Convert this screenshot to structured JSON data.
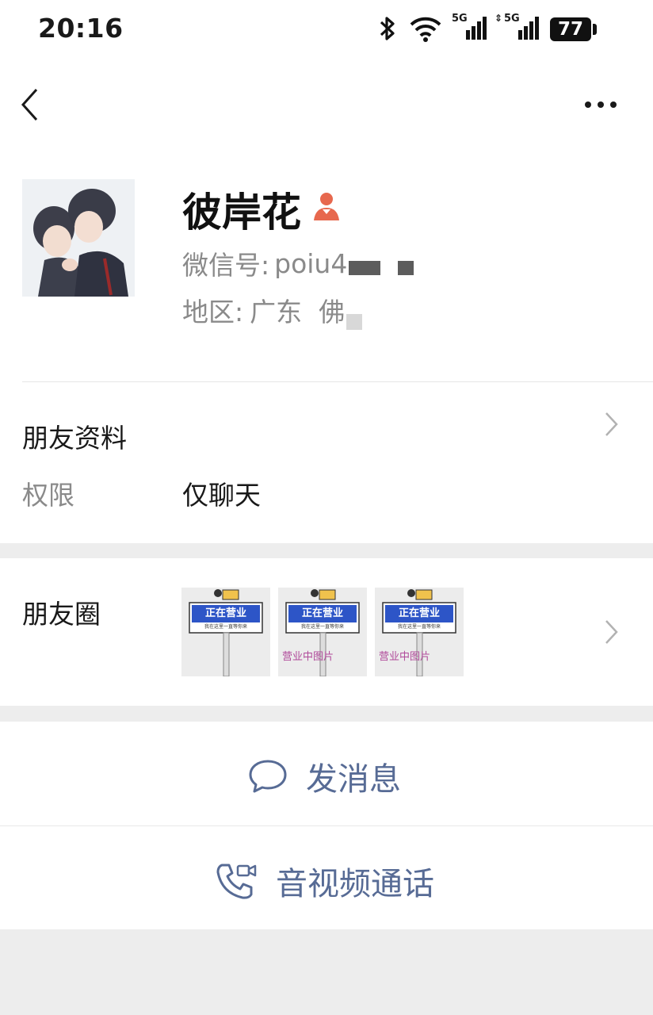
{
  "status_bar": {
    "time": "20:16",
    "battery": "77",
    "network1": "5G",
    "network2": "5G"
  },
  "profile": {
    "nickname": "彼岸花",
    "wechat_id_label": "微信号:",
    "wechat_id_value": "poiu4",
    "region_label": "地区:",
    "region_value": "广东  佛"
  },
  "info": {
    "title": "朋友资料",
    "permission_label": "权限",
    "permission_value": "仅聊天"
  },
  "moments": {
    "title": "朋友圈",
    "thumbnails": [
      {
        "sign_text": "正在营业",
        "sub_text": "我在这里一直等你来",
        "caption": ""
      },
      {
        "sign_text": "正在营业",
        "sub_text": "我在这里一直等你来",
        "caption": "营业中图片"
      },
      {
        "sign_text": "正在营业",
        "sub_text": "我在这里一直等你来",
        "caption": "营业中图片"
      }
    ]
  },
  "actions": {
    "message": "发消息",
    "call": "音视频通话"
  },
  "colors": {
    "link": "#576b95",
    "background": "#ededed",
    "gender": "#e7684e",
    "sign_blue": "#2d55c7"
  }
}
